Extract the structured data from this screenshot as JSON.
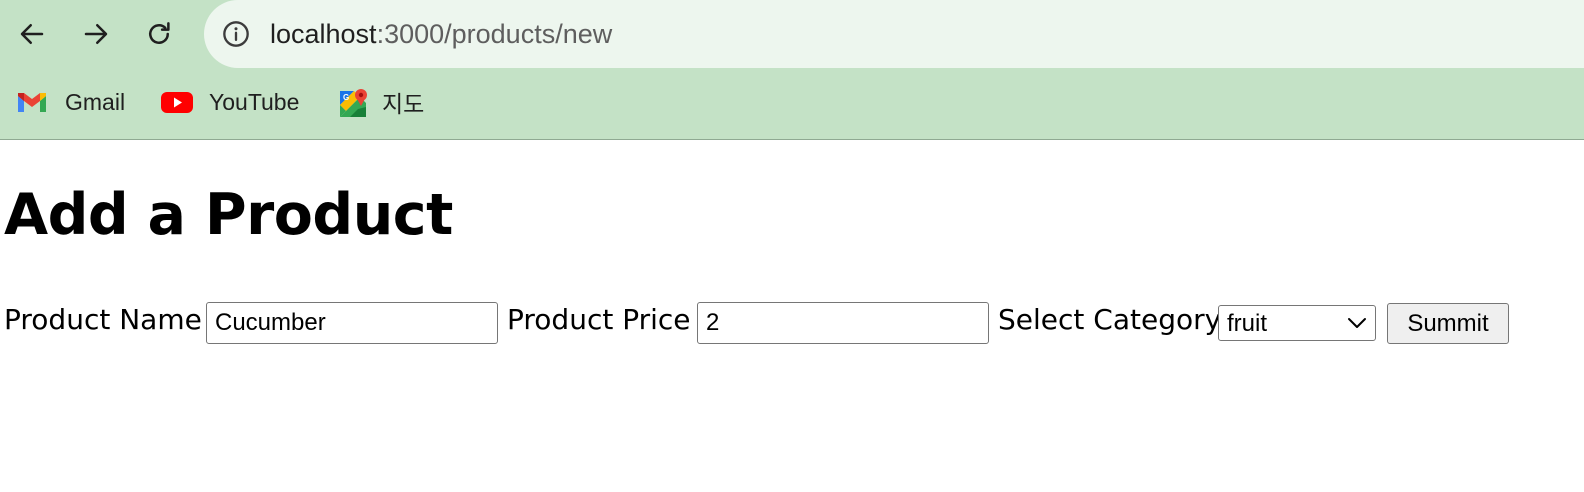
{
  "browser": {
    "url_host": "localhost",
    "url_rest": ":3000/products/new",
    "bookmarks": [
      {
        "label": "Gmail",
        "icon": "gmail-icon"
      },
      {
        "label": "YouTube",
        "icon": "youtube-icon"
      },
      {
        "label": "지도",
        "icon": "google-maps-icon"
      }
    ]
  },
  "page": {
    "title": "Add a Product",
    "form": {
      "name_label": "Product Name",
      "name_value": "Cucumber",
      "price_label": "Product Price",
      "price_value": "2",
      "category_label": "Select Category",
      "category_value": "fruit",
      "submit_label": "Summit"
    }
  },
  "colors": {
    "toolbar_bg": "#c4e2c6",
    "omnibox_bg": "#edf6ee",
    "youtube_red": "#ff0000"
  }
}
